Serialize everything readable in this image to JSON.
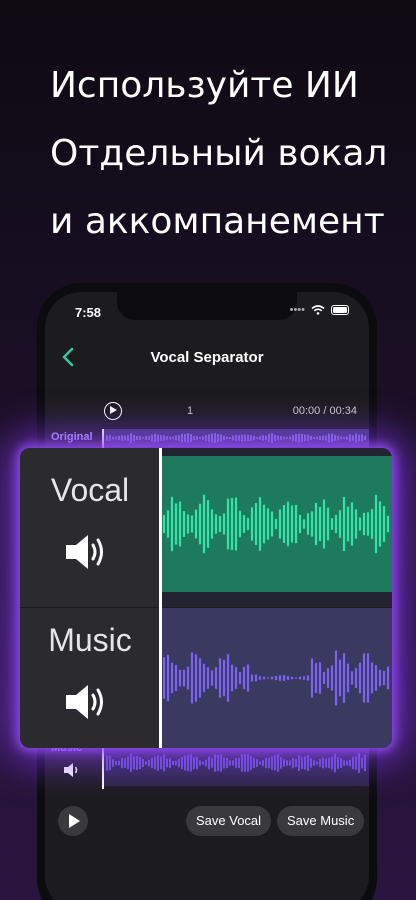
{
  "headline": {
    "line1": "Используйте ИИ",
    "line2": "Отдельный вокал",
    "line3": "и аккомпанемент"
  },
  "status_bar": {
    "time": "7:58"
  },
  "nav": {
    "back_icon": "chevron-left-icon",
    "title": "Vocal Separator"
  },
  "timeline": {
    "marker": "1",
    "time": "00:00 / 00:34"
  },
  "tracks": {
    "original_label": "Original",
    "music_label": "Music"
  },
  "popup": {
    "vocal_label": "Vocal",
    "music_label": "Music",
    "speaker_icon": "speaker-icon"
  },
  "actions": {
    "save_vocal": "Save Vocal",
    "save_music": "Save Music"
  },
  "colors": {
    "accent": "#2ecfa0",
    "vocal_lane": "#1e7a5d",
    "vocal_wave": "#34e3a6",
    "music_lane": "#3a3960",
    "music_wave": "#7b62f0",
    "glow": "#8c3cff"
  }
}
